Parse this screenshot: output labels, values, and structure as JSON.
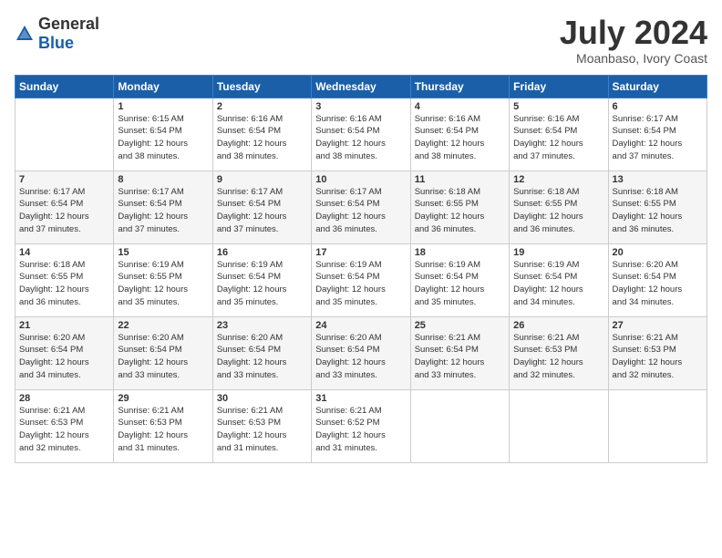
{
  "logo": {
    "general": "General",
    "blue": "Blue"
  },
  "header": {
    "month": "July 2024",
    "location": "Moanbaso, Ivory Coast"
  },
  "weekdays": [
    "Sunday",
    "Monday",
    "Tuesday",
    "Wednesday",
    "Thursday",
    "Friday",
    "Saturday"
  ],
  "rows": [
    [
      {
        "day": "",
        "info": ""
      },
      {
        "day": "1",
        "info": "Sunrise: 6:15 AM\nSunset: 6:54 PM\nDaylight: 12 hours\nand 38 minutes."
      },
      {
        "day": "2",
        "info": "Sunrise: 6:16 AM\nSunset: 6:54 PM\nDaylight: 12 hours\nand 38 minutes."
      },
      {
        "day": "3",
        "info": "Sunrise: 6:16 AM\nSunset: 6:54 PM\nDaylight: 12 hours\nand 38 minutes."
      },
      {
        "day": "4",
        "info": "Sunrise: 6:16 AM\nSunset: 6:54 PM\nDaylight: 12 hours\nand 38 minutes."
      },
      {
        "day": "5",
        "info": "Sunrise: 6:16 AM\nSunset: 6:54 PM\nDaylight: 12 hours\nand 37 minutes."
      },
      {
        "day": "6",
        "info": "Sunrise: 6:17 AM\nSunset: 6:54 PM\nDaylight: 12 hours\nand 37 minutes."
      }
    ],
    [
      {
        "day": "7",
        "info": "Sunrise: 6:17 AM\nSunset: 6:54 PM\nDaylight: 12 hours\nand 37 minutes."
      },
      {
        "day": "8",
        "info": "Sunrise: 6:17 AM\nSunset: 6:54 PM\nDaylight: 12 hours\nand 37 minutes."
      },
      {
        "day": "9",
        "info": "Sunrise: 6:17 AM\nSunset: 6:54 PM\nDaylight: 12 hours\nand 37 minutes."
      },
      {
        "day": "10",
        "info": "Sunrise: 6:17 AM\nSunset: 6:54 PM\nDaylight: 12 hours\nand 36 minutes."
      },
      {
        "day": "11",
        "info": "Sunrise: 6:18 AM\nSunset: 6:55 PM\nDaylight: 12 hours\nand 36 minutes."
      },
      {
        "day": "12",
        "info": "Sunrise: 6:18 AM\nSunset: 6:55 PM\nDaylight: 12 hours\nand 36 minutes."
      },
      {
        "day": "13",
        "info": "Sunrise: 6:18 AM\nSunset: 6:55 PM\nDaylight: 12 hours\nand 36 minutes."
      }
    ],
    [
      {
        "day": "14",
        "info": "Sunrise: 6:18 AM\nSunset: 6:55 PM\nDaylight: 12 hours\nand 36 minutes."
      },
      {
        "day": "15",
        "info": "Sunrise: 6:19 AM\nSunset: 6:55 PM\nDaylight: 12 hours\nand 35 minutes."
      },
      {
        "day": "16",
        "info": "Sunrise: 6:19 AM\nSunset: 6:54 PM\nDaylight: 12 hours\nand 35 minutes."
      },
      {
        "day": "17",
        "info": "Sunrise: 6:19 AM\nSunset: 6:54 PM\nDaylight: 12 hours\nand 35 minutes."
      },
      {
        "day": "18",
        "info": "Sunrise: 6:19 AM\nSunset: 6:54 PM\nDaylight: 12 hours\nand 35 minutes."
      },
      {
        "day": "19",
        "info": "Sunrise: 6:19 AM\nSunset: 6:54 PM\nDaylight: 12 hours\nand 34 minutes."
      },
      {
        "day": "20",
        "info": "Sunrise: 6:20 AM\nSunset: 6:54 PM\nDaylight: 12 hours\nand 34 minutes."
      }
    ],
    [
      {
        "day": "21",
        "info": "Sunrise: 6:20 AM\nSunset: 6:54 PM\nDaylight: 12 hours\nand 34 minutes."
      },
      {
        "day": "22",
        "info": "Sunrise: 6:20 AM\nSunset: 6:54 PM\nDaylight: 12 hours\nand 33 minutes."
      },
      {
        "day": "23",
        "info": "Sunrise: 6:20 AM\nSunset: 6:54 PM\nDaylight: 12 hours\nand 33 minutes."
      },
      {
        "day": "24",
        "info": "Sunrise: 6:20 AM\nSunset: 6:54 PM\nDaylight: 12 hours\nand 33 minutes."
      },
      {
        "day": "25",
        "info": "Sunrise: 6:21 AM\nSunset: 6:54 PM\nDaylight: 12 hours\nand 33 minutes."
      },
      {
        "day": "26",
        "info": "Sunrise: 6:21 AM\nSunset: 6:53 PM\nDaylight: 12 hours\nand 32 minutes."
      },
      {
        "day": "27",
        "info": "Sunrise: 6:21 AM\nSunset: 6:53 PM\nDaylight: 12 hours\nand 32 minutes."
      }
    ],
    [
      {
        "day": "28",
        "info": "Sunrise: 6:21 AM\nSunset: 6:53 PM\nDaylight: 12 hours\nand 32 minutes."
      },
      {
        "day": "29",
        "info": "Sunrise: 6:21 AM\nSunset: 6:53 PM\nDaylight: 12 hours\nand 31 minutes."
      },
      {
        "day": "30",
        "info": "Sunrise: 6:21 AM\nSunset: 6:53 PM\nDaylight: 12 hours\nand 31 minutes."
      },
      {
        "day": "31",
        "info": "Sunrise: 6:21 AM\nSunset: 6:52 PM\nDaylight: 12 hours\nand 31 minutes."
      },
      {
        "day": "",
        "info": ""
      },
      {
        "day": "",
        "info": ""
      },
      {
        "day": "",
        "info": ""
      }
    ]
  ]
}
